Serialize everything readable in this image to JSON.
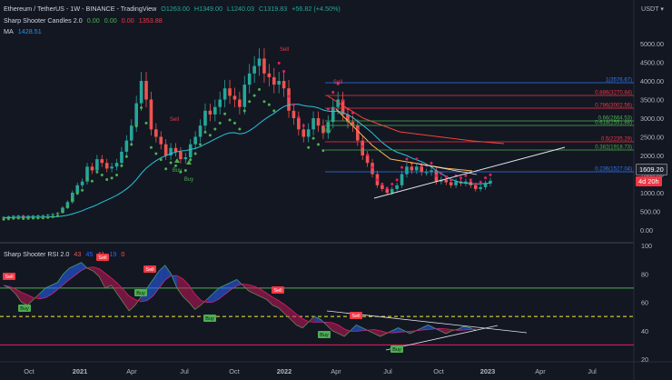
{
  "header": {
    "symbol": "Ethereum / TetherUS - 1W - BINANCE - TradingView",
    "ohlc": {
      "o": "O1263.00",
      "h": "H1349.00",
      "l": "L1240.03",
      "c": "C1319.83",
      "chg": "+56.82 (+4.50%)"
    },
    "indicator1": {
      "name": "Sharp Shooter Candles 2.0",
      "v1": "0.00",
      "v2": "0.00",
      "v3": "0.00",
      "v4": "1353.88"
    },
    "indicator2": {
      "name": "MA",
      "value": "1428.51"
    },
    "rsi_title": "Sharp Shooter RSI 2.0",
    "rsi_vals": [
      "43",
      "45",
      "41",
      "19",
      "0"
    ],
    "currency": "USDT",
    "price_tag": "1609.20",
    "time_tag": "4d 20h"
  },
  "price_axis": [
    "5000.00",
    "4500.00",
    "4000.00",
    "3500.00",
    "3000.00",
    "2500.00",
    "2000.00",
    "1500.00",
    "1000.00",
    "500.00",
    "0.00"
  ],
  "rsi_axis": [
    "100",
    "80",
    "60",
    "40",
    "20"
  ],
  "time_axis": [
    "Oct",
    "2021",
    "Apr",
    "Jul",
    "Oct",
    "2022",
    "Apr",
    "Jul",
    "Oct",
    "2023",
    "Apr",
    "Jul"
  ],
  "fib_levels": [
    {
      "label": "1(3576.67)",
      "color": "#3179f5"
    },
    {
      "label": "0.886(3270.84)",
      "color": "#f23645"
    },
    {
      "label": "0.786(3002.56)",
      "color": "#f23645"
    },
    {
      "label": "0.66(2664.53)",
      "color": "#4caf50"
    },
    {
      "label": "0.618(2551.88)",
      "color": "#4caf50"
    },
    {
      "label": "0.5(2235.29)",
      "color": "#f23645"
    },
    {
      "label": "0.382(1918.73)",
      "color": "#4caf50"
    },
    {
      "label": "0.236(1527.04)",
      "color": "#3179f5"
    }
  ],
  "signals": {
    "buy": "Buy",
    "sell": "Sell"
  },
  "colors": {
    "bull": "#26a69a",
    "bear": "#ef5350",
    "dotBull": "#4caf50",
    "dotBear": "#e91e63",
    "ma": "#2196f3",
    "bg": "#131722"
  }
}
